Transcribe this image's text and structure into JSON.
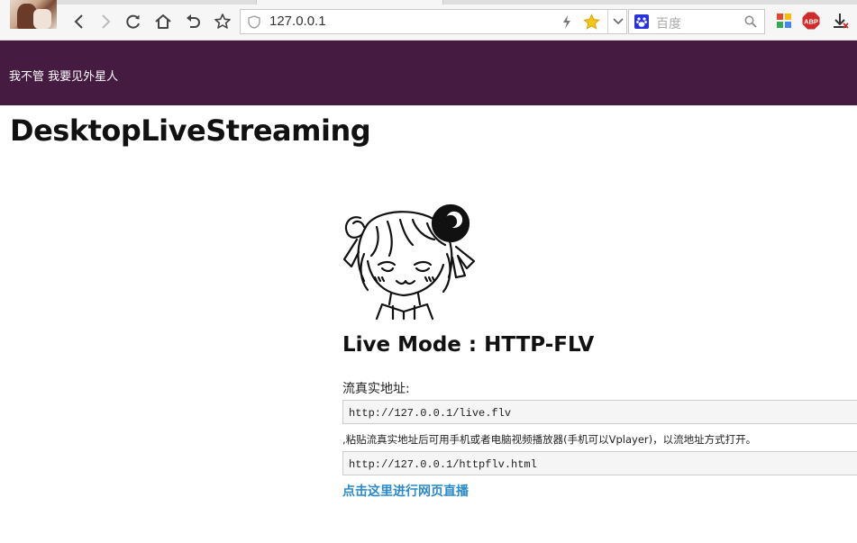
{
  "browser": {
    "url": "127.0.0.1",
    "search_placeholder": "百度",
    "abp_label": "ABP"
  },
  "header": {
    "brand": "我不管 我要见外星人"
  },
  "main": {
    "title": "DesktopLiveStreaming",
    "mode_title": "Live Mode : HTTP-FLV",
    "address_label": "流真实地址:",
    "flv_url": "http://127.0.0.1/live.flv",
    "note": ",粘贴流真实地址后可用手机或者电脑视频播放器(手机可以Vplayer)，以流地址方式打开。",
    "page_url": "http://127.0.0.1/httpflv.html",
    "live_link": "点击这里进行网页直播"
  },
  "colors": {
    "header_bg": "#451b42",
    "link": "#2a8ac9"
  },
  "icons": [
    "back-icon",
    "forward-icon",
    "reload-icon",
    "home-icon",
    "undo-icon",
    "bookmark-star-icon",
    "shield-icon",
    "lightning-icon",
    "favorite-star-icon",
    "chevron-down-icon",
    "baidu-paw-icon",
    "search-icon",
    "apps-grid-icon",
    "adblock-icon",
    "download-icon",
    "mascot-image"
  ]
}
